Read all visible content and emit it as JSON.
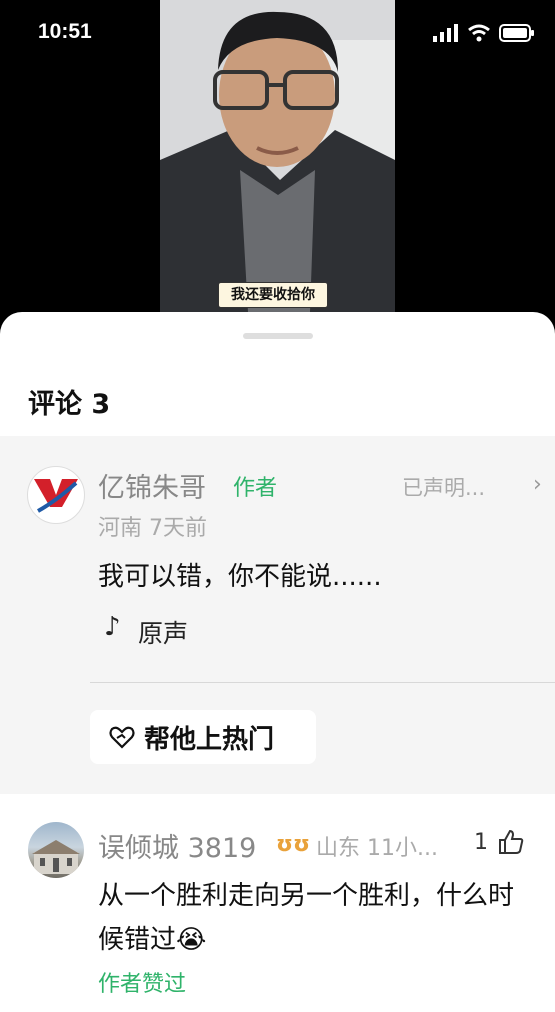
{
  "status": {
    "time": "10:51"
  },
  "video": {
    "subtitle": "我还要收拾你"
  },
  "sheet": {
    "title": "评论 3"
  },
  "pinned_comment": {
    "author": "亿锦朱哥",
    "author_badge": "作者",
    "declaration": "已声明...",
    "meta": "河南 7天前",
    "text": "我可以错，你不能说......",
    "music_icon": "♪",
    "music_label": "原声",
    "boost_label": "帮他上热门"
  },
  "comment": {
    "author": "误倾城 3819",
    "badge_icon": "ʊʊ",
    "meta": "山东 11小...",
    "likes": "1",
    "text": "从一个胜利走向另一个胜利，什么时候错过😭",
    "liked_by_author": "作者赞过"
  },
  "colors": {
    "accent_green": "#2fb36a",
    "bg_pinned": "#f5f5f5"
  }
}
